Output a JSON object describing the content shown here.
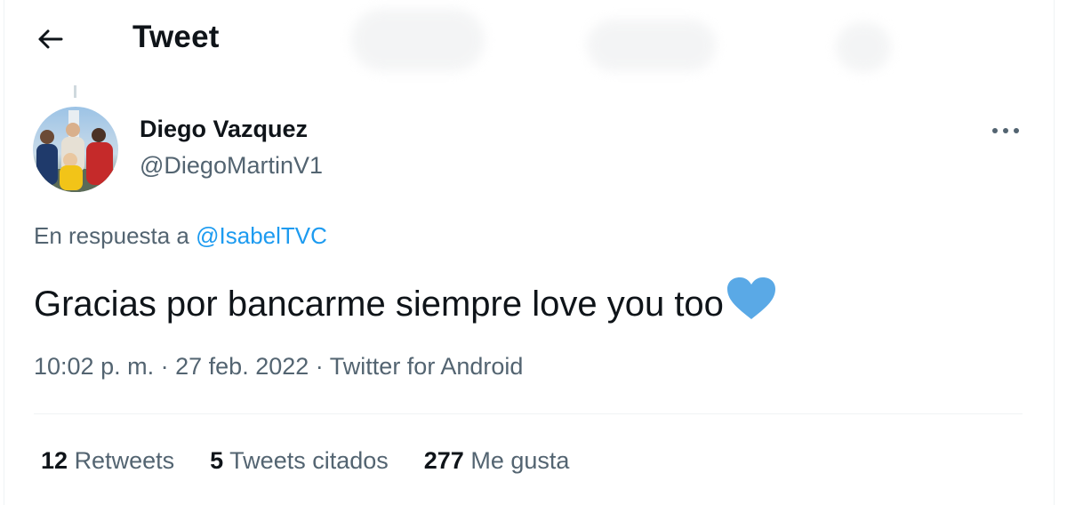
{
  "header": {
    "title": "Tweet",
    "back_icon": "arrow-left-icon"
  },
  "tweet": {
    "author": {
      "display_name": "Diego Vazquez",
      "username": "@DiegoMartinV1"
    },
    "reply_context": {
      "prefix": "En respuesta a",
      "handle": "@IsabelTVC"
    },
    "text": "Gracias por bancarme siempre love you too",
    "emoji": "blue-heart-icon",
    "meta": {
      "time": "10:02 p. m.",
      "separator": "·",
      "date": "27 feb. 2022",
      "source": "Twitter for Android"
    },
    "stats": {
      "retweets_count": "12",
      "retweets_label": "Retweets",
      "quotes_count": "5",
      "quotes_label": "Tweets citados",
      "likes_count": "277",
      "likes_label": "Me gusta"
    }
  },
  "colors": {
    "text_primary": "#0f1419",
    "text_secondary": "#536471",
    "link": "#1d9bf0",
    "heart": "#5aa9e6",
    "divider": "#eff3f4"
  }
}
